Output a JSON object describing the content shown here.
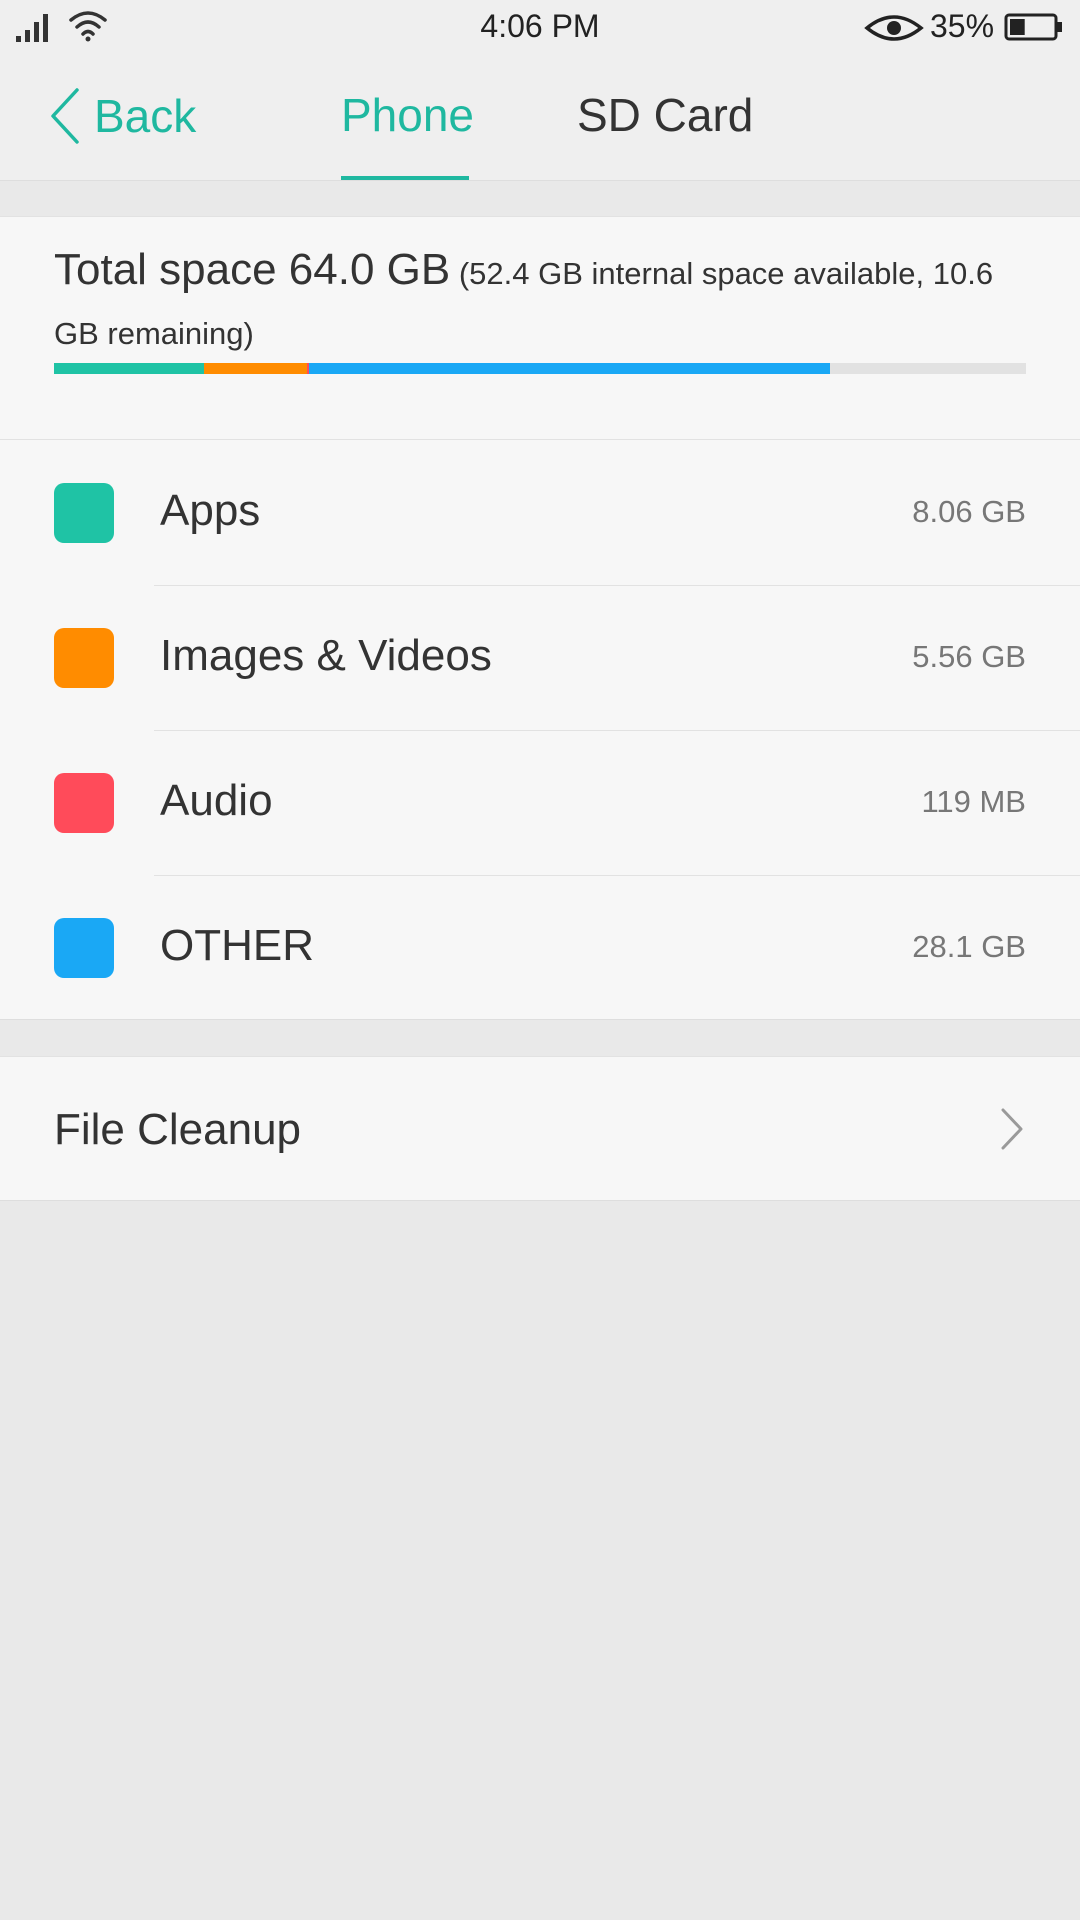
{
  "status_bar": {
    "time": "4:06 PM",
    "battery_percent": "35%",
    "battery_level": 0.35,
    "icons": [
      "signal-icon",
      "wifi-icon",
      "eye-icon",
      "battery-icon"
    ]
  },
  "header": {
    "back_label": "Back",
    "tabs": [
      {
        "label": "Phone",
        "active": true
      },
      {
        "label": "SD Card",
        "active": false
      }
    ]
  },
  "summary": {
    "total": "Total space 64.0 GB",
    "detail": " (52.4 GB internal space available, 10.6 GB remaining)",
    "usage_fractions": {
      "apps": 0.154,
      "images_videos": 0.106,
      "audio": 0.002,
      "other": 0.536
    }
  },
  "categories": [
    {
      "label": "Apps",
      "size": "8.06 GB",
      "color": "#1fc3a5"
    },
    {
      "label": "Images & Videos",
      "size": "5.56 GB",
      "color": "#ff8c00"
    },
    {
      "label": "Audio",
      "size": "119 MB",
      "color": "#ff4b5a"
    },
    {
      "label": "OTHER",
      "size": "28.1 GB",
      "color": "#1aa8f5"
    }
  ],
  "file_cleanup": {
    "label": "File Cleanup"
  },
  "colors": {
    "accent": "#1fb8a0",
    "bar_track": "#e2e2e2"
  }
}
